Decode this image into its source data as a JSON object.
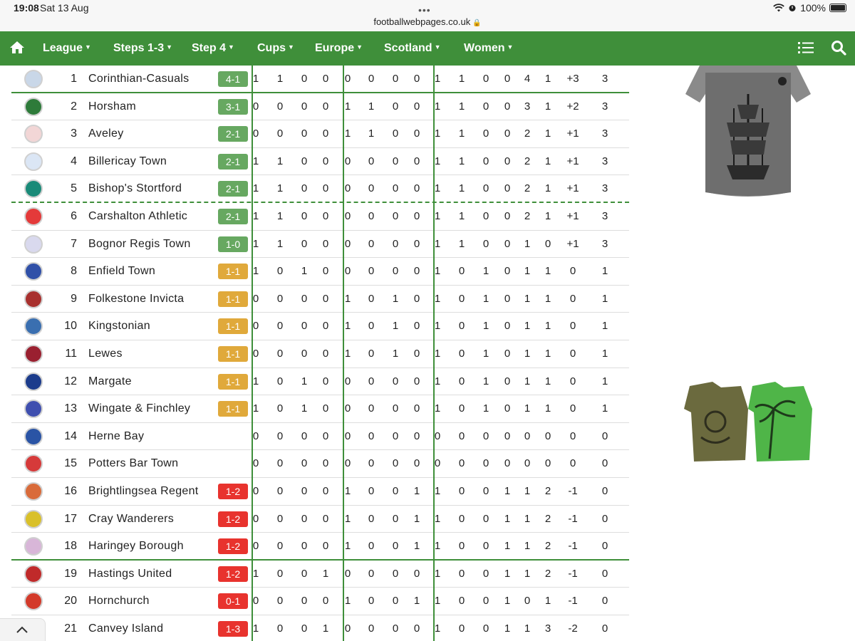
{
  "status_bar": {
    "time": "19:08",
    "date": "Sat 13 Aug",
    "url": "footballwebpages.co.uk",
    "battery": "100%"
  },
  "nav": {
    "items": [
      {
        "label": "League"
      },
      {
        "label": "Steps 1-3"
      },
      {
        "label": "Step 4"
      },
      {
        "label": "Cups"
      },
      {
        "label": "Europe"
      },
      {
        "label": "Scotland"
      },
      {
        "label": "Women"
      }
    ],
    "icons": [
      "home-icon",
      "list-icon",
      "search-icon"
    ],
    "color": "#3f8f3a"
  },
  "colors": {
    "result_win": "#67a861",
    "result_draw": "#e0a93b",
    "result_loss": "#e8332e",
    "divider": "#3f8f3a"
  },
  "table": {
    "rows": [
      {
        "pos": "1",
        "team": "Corinthian-Casuals",
        "result": "4-1",
        "result_type": "green",
        "cells": [
          "1",
          "1",
          "0",
          "0",
          "0",
          "0",
          "0",
          "0",
          "1",
          "1",
          "0",
          "0",
          "4",
          "1",
          "+3",
          "3"
        ]
      },
      {
        "pos": "2",
        "team": "Horsham",
        "result": "3-1",
        "result_type": "green",
        "cells": [
          "0",
          "0",
          "0",
          "0",
          "1",
          "1",
          "0",
          "0",
          "1",
          "1",
          "0",
          "0",
          "3",
          "1",
          "+2",
          "3"
        ]
      },
      {
        "pos": "3",
        "team": "Aveley",
        "result": "2-1",
        "result_type": "green",
        "cells": [
          "0",
          "0",
          "0",
          "0",
          "1",
          "1",
          "0",
          "0",
          "1",
          "1",
          "0",
          "0",
          "2",
          "1",
          "+1",
          "3"
        ]
      },
      {
        "pos": "4",
        "team": "Billericay Town",
        "result": "2-1",
        "result_type": "green",
        "cells": [
          "1",
          "1",
          "0",
          "0",
          "0",
          "0",
          "0",
          "0",
          "1",
          "1",
          "0",
          "0",
          "2",
          "1",
          "+1",
          "3"
        ]
      },
      {
        "pos": "5",
        "team": "Bishop's Stortford",
        "result": "2-1",
        "result_type": "green",
        "cells": [
          "1",
          "1",
          "0",
          "0",
          "0",
          "0",
          "0",
          "0",
          "1",
          "1",
          "0",
          "0",
          "2",
          "1",
          "+1",
          "3"
        ]
      },
      {
        "pos": "6",
        "team": "Carshalton Athletic",
        "result": "2-1",
        "result_type": "green",
        "cells": [
          "1",
          "1",
          "0",
          "0",
          "0",
          "0",
          "0",
          "0",
          "1",
          "1",
          "0",
          "0",
          "2",
          "1",
          "+1",
          "3"
        ]
      },
      {
        "pos": "7",
        "team": "Bognor Regis Town",
        "result": "1-0",
        "result_type": "green",
        "cells": [
          "1",
          "1",
          "0",
          "0",
          "0",
          "0",
          "0",
          "0",
          "1",
          "1",
          "0",
          "0",
          "1",
          "0",
          "+1",
          "3"
        ]
      },
      {
        "pos": "8",
        "team": "Enfield Town",
        "result": "1-1",
        "result_type": "amber",
        "cells": [
          "1",
          "0",
          "1",
          "0",
          "0",
          "0",
          "0",
          "0",
          "1",
          "0",
          "1",
          "0",
          "1",
          "1",
          "0",
          "1"
        ]
      },
      {
        "pos": "9",
        "team": "Folkestone Invicta",
        "result": "1-1",
        "result_type": "amber",
        "cells": [
          "0",
          "0",
          "0",
          "0",
          "1",
          "0",
          "1",
          "0",
          "1",
          "0",
          "1",
          "0",
          "1",
          "1",
          "0",
          "1"
        ]
      },
      {
        "pos": "10",
        "team": "Kingstonian",
        "result": "1-1",
        "result_type": "amber",
        "cells": [
          "0",
          "0",
          "0",
          "0",
          "1",
          "0",
          "1",
          "0",
          "1",
          "0",
          "1",
          "0",
          "1",
          "1",
          "0",
          "1"
        ]
      },
      {
        "pos": "11",
        "team": "Lewes",
        "result": "1-1",
        "result_type": "amber",
        "cells": [
          "0",
          "0",
          "0",
          "0",
          "1",
          "0",
          "1",
          "0",
          "1",
          "0",
          "1",
          "0",
          "1",
          "1",
          "0",
          "1"
        ]
      },
      {
        "pos": "12",
        "team": "Margate",
        "result": "1-1",
        "result_type": "amber",
        "cells": [
          "1",
          "0",
          "1",
          "0",
          "0",
          "0",
          "0",
          "0",
          "1",
          "0",
          "1",
          "0",
          "1",
          "1",
          "0",
          "1"
        ]
      },
      {
        "pos": "13",
        "team": "Wingate & Finchley",
        "result": "1-1",
        "result_type": "amber",
        "cells": [
          "1",
          "0",
          "1",
          "0",
          "0",
          "0",
          "0",
          "0",
          "1",
          "0",
          "1",
          "0",
          "1",
          "1",
          "0",
          "1"
        ]
      },
      {
        "pos": "14",
        "team": "Herne Bay",
        "result": "",
        "result_type": "",
        "cells": [
          "0",
          "0",
          "0",
          "0",
          "0",
          "0",
          "0",
          "0",
          "0",
          "0",
          "0",
          "0",
          "0",
          "0",
          "0",
          "0"
        ]
      },
      {
        "pos": "15",
        "team": "Potters Bar Town",
        "result": "",
        "result_type": "",
        "cells": [
          "0",
          "0",
          "0",
          "0",
          "0",
          "0",
          "0",
          "0",
          "0",
          "0",
          "0",
          "0",
          "0",
          "0",
          "0",
          "0"
        ]
      },
      {
        "pos": "16",
        "team": "Brightlingsea Regent",
        "result": "1-2",
        "result_type": "red",
        "cells": [
          "0",
          "0",
          "0",
          "0",
          "1",
          "0",
          "0",
          "1",
          "1",
          "0",
          "0",
          "1",
          "1",
          "2",
          "-1",
          "0"
        ]
      },
      {
        "pos": "17",
        "team": "Cray Wanderers",
        "result": "1-2",
        "result_type": "red",
        "cells": [
          "0",
          "0",
          "0",
          "0",
          "1",
          "0",
          "0",
          "1",
          "1",
          "0",
          "0",
          "1",
          "1",
          "2",
          "-1",
          "0"
        ]
      },
      {
        "pos": "18",
        "team": "Haringey Borough",
        "result": "1-2",
        "result_type": "red",
        "cells": [
          "0",
          "0",
          "0",
          "0",
          "1",
          "0",
          "0",
          "1",
          "1",
          "0",
          "0",
          "1",
          "1",
          "2",
          "-1",
          "0"
        ]
      },
      {
        "pos": "19",
        "team": "Hastings United",
        "result": "1-2",
        "result_type": "red",
        "cells": [
          "1",
          "0",
          "0",
          "1",
          "0",
          "0",
          "0",
          "0",
          "1",
          "0",
          "0",
          "1",
          "1",
          "2",
          "-1",
          "0"
        ]
      },
      {
        "pos": "20",
        "team": "Hornchurch",
        "result": "0-1",
        "result_type": "red",
        "cells": [
          "0",
          "0",
          "0",
          "0",
          "1",
          "0",
          "0",
          "1",
          "1",
          "0",
          "0",
          "1",
          "0",
          "1",
          "-1",
          "0"
        ]
      },
      {
        "pos": "21",
        "team": "Canvey Island",
        "result": "1-3",
        "result_type": "red",
        "cells": [
          "1",
          "0",
          "0",
          "1",
          "0",
          "0",
          "0",
          "0",
          "1",
          "0",
          "0",
          "1",
          "1",
          "3",
          "-2",
          "0"
        ]
      }
    ]
  },
  "ads": [
    "ship-tshirt-ad",
    "henley-shirts-ad"
  ]
}
